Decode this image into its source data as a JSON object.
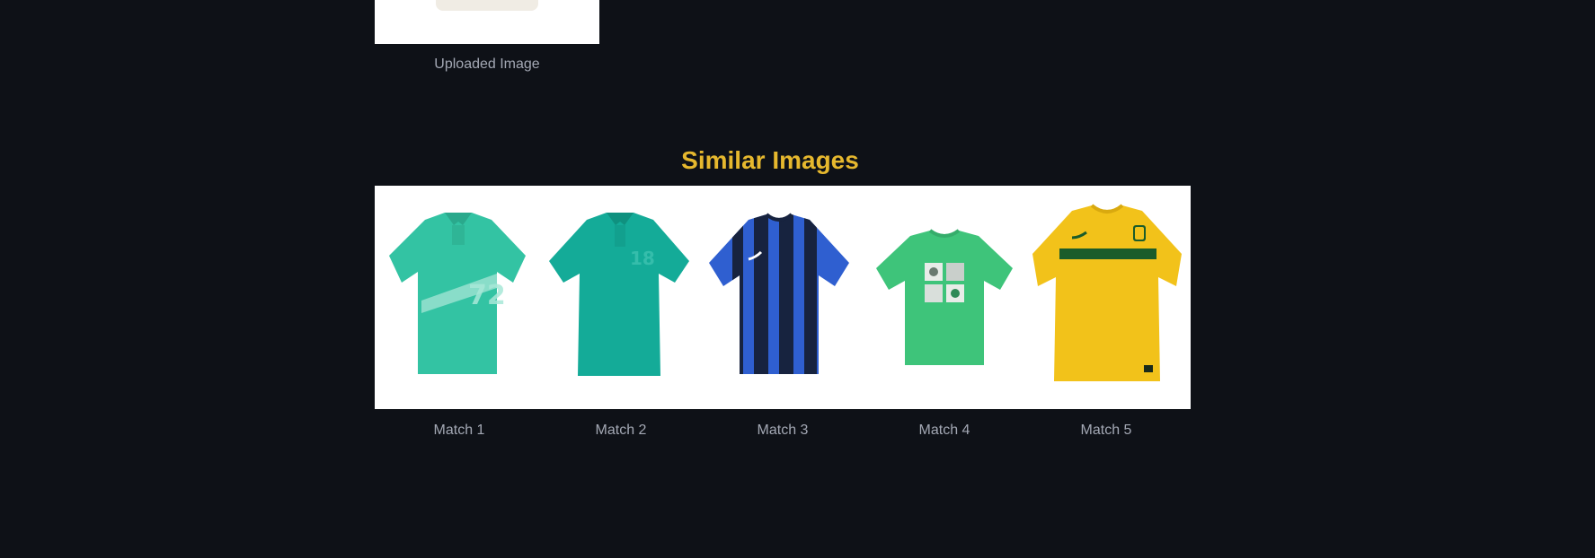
{
  "uploaded": {
    "caption": "Uploaded Image"
  },
  "results": {
    "title": "Similar Images",
    "title_color": "#e6b82e",
    "matches": [
      {
        "label": "Match 1",
        "image": "teal-polo-shirt-image"
      },
      {
        "label": "Match 2",
        "image": "teal-polo-shirt-image"
      },
      {
        "label": "Match 3",
        "image": "blue-black-striped-jersey-image"
      },
      {
        "label": "Match 4",
        "image": "green-graphic-tshirt-image"
      },
      {
        "label": "Match 5",
        "image": "yellow-soccer-jersey-image"
      }
    ]
  },
  "theme": {
    "background": "#0e1117",
    "caption_color": "#a3a8b4"
  }
}
